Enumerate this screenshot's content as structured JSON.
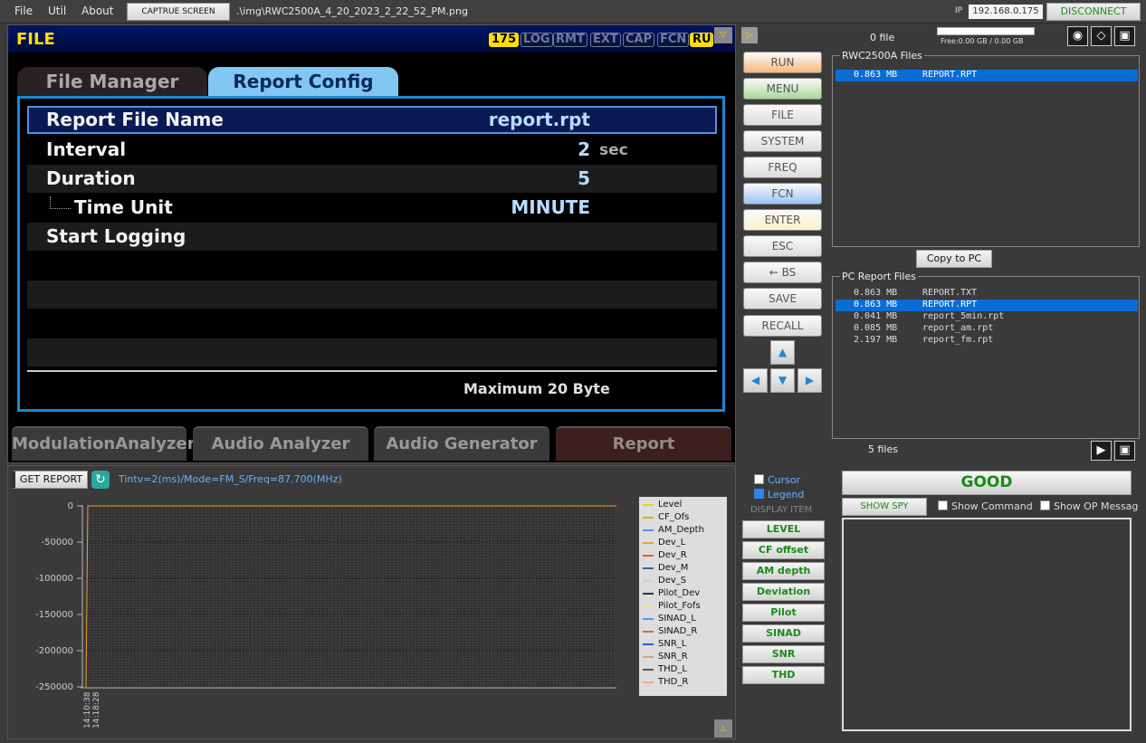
{
  "menu": {
    "file": "File",
    "util": "Util",
    "about": "About",
    "capture": "CAPTRUE SCREEN",
    "image_path": ".\\img\\RWC2500A_4_20_2023_2_22_52_PM.png"
  },
  "connection": {
    "ip_label": "IP",
    "ip": "192.168.0.175",
    "disconnect": "DISCONNECT"
  },
  "screen": {
    "title": "FILE",
    "status": [
      "175",
      "LOG",
      "RMT",
      "EXT",
      "CAP",
      "FCN",
      "RUI"
    ],
    "tabs": {
      "file_manager": "File Manager",
      "report_config": "Report Config"
    },
    "rows": [
      {
        "label": "Report File Name",
        "value": "report.rpt",
        "unit": ""
      },
      {
        "label": "Interval",
        "value": "2",
        "unit": "sec"
      },
      {
        "label": "Duration",
        "value": "5",
        "unit": ""
      },
      {
        "label": "Time Unit",
        "value": "MINUTE",
        "unit": ""
      },
      {
        "label": "Start Logging",
        "value": "",
        "unit": ""
      }
    ],
    "hint": "Maximum 20 Byte",
    "modes": [
      "ModulationAnalyzer",
      "Audio Analyzer",
      "Audio Generator",
      "Report"
    ],
    "scroll_icon": "chevron-down-icon"
  },
  "hw_buttons": [
    {
      "label": "RUN",
      "color": "#f5b87a"
    },
    {
      "label": "MENU",
      "color": "#a9d89b"
    },
    {
      "label": "FILE",
      "color": "#dcdcdc"
    },
    {
      "label": "SYSTEM",
      "color": "#dcdcdc"
    },
    {
      "label": "FREQ",
      "color": "#dcdcdc"
    },
    {
      "label": "FCN",
      "color": "#9cc3f5"
    },
    {
      "label": "ENTER",
      "color": "#fbf0c6"
    },
    {
      "label": "ESC",
      "color": "#dcdcdc"
    },
    {
      "label": "← BS",
      "color": "#dcdcdc"
    },
    {
      "label": "SAVE",
      "color": "#dcdcdc"
    },
    {
      "label": "RECALL",
      "color": "#dcdcdc"
    }
  ],
  "files": {
    "count": "0 file",
    "disk_free": "Free:0.00 GB / 0.00 GB",
    "device_title": "RWC2500A Files",
    "device_files": [
      {
        "size": "0.863 MB",
        "name": "REPORT.RPT",
        "selected": true
      }
    ],
    "copy_button": "Copy to PC",
    "pc_title": "PC Report Files",
    "pc_files": [
      {
        "size": "0.863 MB",
        "name": "REPORT.TXT",
        "selected": false
      },
      {
        "size": "0.863 MB",
        "name": "REPORT.RPT",
        "selected": true
      },
      {
        "size": "0.041 MB",
        "name": "report_5min.rpt",
        "selected": false
      },
      {
        "size": "0.085 MB",
        "name": "report_am.rpt",
        "selected": false
      },
      {
        "size": "2.197 MB",
        "name": "report_fm.rpt",
        "selected": false
      }
    ],
    "pc_count": "5 files"
  },
  "chart": {
    "get_report": "GET REPORT",
    "info": "Tintv=2(ms)/Mode=FM_S/Freq=87.700(MHz)",
    "yticks": [
      "0",
      "-50000",
      "-100000",
      "-150000",
      "-200000",
      "-250000"
    ],
    "xticks": [
      "14:10:38",
      "14:18:28"
    ],
    "legend": [
      {
        "name": "Level",
        "color": "#e8d800"
      },
      {
        "name": "CF_Ofs",
        "color": "#e8a800"
      },
      {
        "name": "AM_Depth",
        "color": "#5a8ede"
      },
      {
        "name": "Dev_L",
        "color": "#f0a030"
      },
      {
        "name": "Dev_R",
        "color": "#e06020"
      },
      {
        "name": "Dev_M",
        "color": "#2a6aa8"
      },
      {
        "name": "Dev_S",
        "color": "#d0d0d0"
      },
      {
        "name": "Pilot_Dev",
        "color": "#333333"
      },
      {
        "name": "Pilot_Fofs",
        "color": "#f0e0a0"
      },
      {
        "name": "SINAD_L",
        "color": "#4aa0e8"
      },
      {
        "name": "SINAD_R",
        "color": "#c07060"
      },
      {
        "name": "SNR_L",
        "color": "#2a5ac8"
      },
      {
        "name": "SNR_R",
        "color": "#e0a070"
      },
      {
        "name": "THD_L",
        "color": "#555555"
      },
      {
        "name": "THD_R",
        "color": "#f0b080"
      }
    ]
  },
  "display": {
    "cursor": "Cursor",
    "legend": "Legend",
    "item_label": "DISPLAY ITEM",
    "buttons": [
      "LEVEL",
      "CF offset",
      "AM depth",
      "Deviation",
      "Pilot",
      "SINAD",
      "SNR",
      "THD"
    ]
  },
  "spy": {
    "status": "GOOD",
    "show_spy": "SHOW SPY",
    "show_command": "Show Command",
    "show_op": "Show OP Messag"
  }
}
